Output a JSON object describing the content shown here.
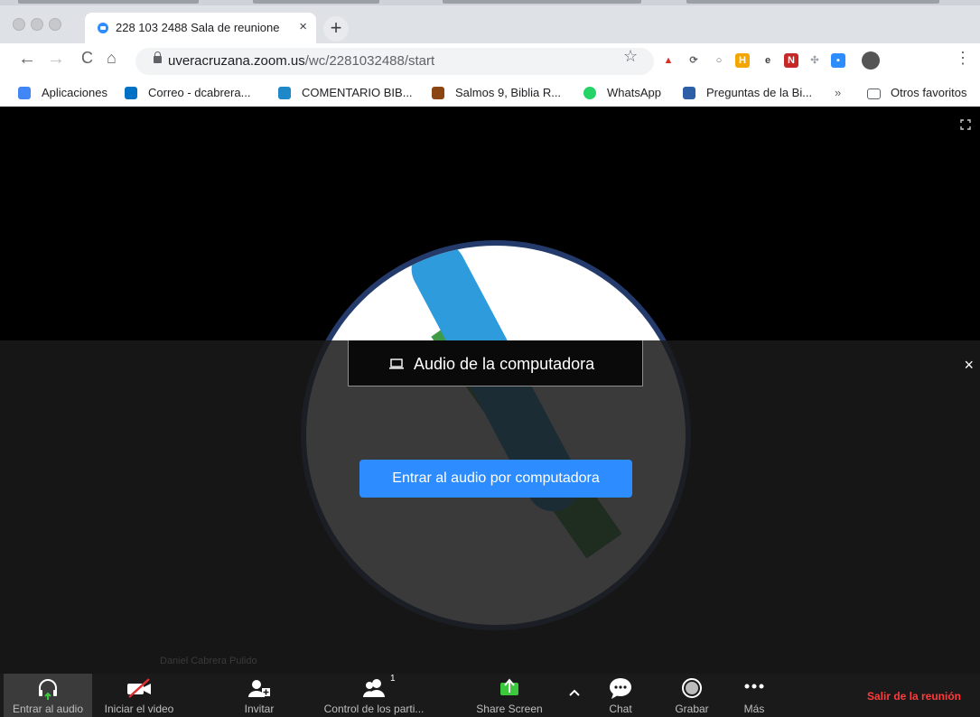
{
  "browser": {
    "tab": {
      "title": "228 103 2488 Sala de reunione",
      "close_icon": "close-icon"
    },
    "new_tab_label": "+",
    "url_host": "uveracruzana.zoom.us",
    "url_path": "/wc/2281032488/start",
    "bookmarks": [
      {
        "label": "Aplicaciones",
        "icon": "apps-grid-icon",
        "color": "#4285f4"
      },
      {
        "label": "Correo - dcabrera...",
        "icon": "outlook-icon",
        "color": "#0072c6"
      },
      {
        "label": "COMENTARIO BIB...",
        "icon": "bible-comment-icon",
        "color": "#1e88c8"
      },
      {
        "label": "Salmos 9, Biblia R...",
        "icon": "bible-icon",
        "color": "#8b4513"
      },
      {
        "label": "WhatsApp",
        "icon": "whatsapp-icon",
        "color": "#25d366"
      },
      {
        "label": "Preguntas de la Bi...",
        "icon": "questions-icon",
        "color": "#2d5fa8"
      }
    ],
    "bookmarks_overflow": "»",
    "other_bookmarks": "Otros favoritos"
  },
  "audio": {
    "tab_label": "Audio de la computadora",
    "join_button": "Entrar al audio por computadora"
  },
  "participant_name": "Daniel Cabrera Pulido",
  "controls": {
    "join_audio": "Entrar al audio",
    "start_video": "Iniciar el video",
    "invite": "Invitar",
    "participants": "Control de los parti...",
    "participants_count": "1",
    "share_screen": "Share Screen",
    "chat": "Chat",
    "record": "Grabar",
    "more": "Más",
    "leave": "Salir de la reunión"
  },
  "colors": {
    "zoom_blue": "#2d8cff",
    "leave_red": "#ff3b3b",
    "share_green": "#3cc83c"
  }
}
